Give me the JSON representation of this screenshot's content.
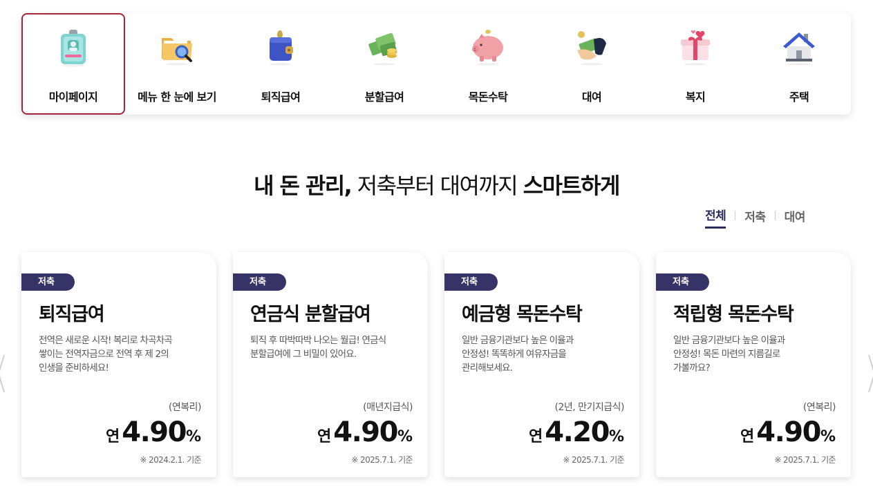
{
  "menu": {
    "items": [
      {
        "label": "마이페이지",
        "icon": "id-badge-icon"
      },
      {
        "label": "메뉴 한 눈에 보기",
        "icon": "folder-search-icon"
      },
      {
        "label": "퇴직급여",
        "icon": "wallet-icon"
      },
      {
        "label": "분할급여",
        "icon": "money-stack-icon"
      },
      {
        "label": "목돈수탁",
        "icon": "piggy-bank-icon"
      },
      {
        "label": "대여",
        "icon": "hand-money-icon"
      },
      {
        "label": "복지",
        "icon": "gift-box-icon"
      },
      {
        "label": "주택",
        "icon": "house-icon"
      }
    ],
    "active_index": 0,
    "active_color": "#a3243b"
  },
  "headline": {
    "part1": "내 돈 관리,",
    "part2": " 저축부터 대여까지 ",
    "part3": "스마트하게"
  },
  "filter": {
    "tabs": [
      "전체",
      "저축",
      "대여"
    ],
    "active_index": 0
  },
  "cards": [
    {
      "badge": "저축",
      "title": "퇴직급여",
      "desc": [
        "전역은 새로운 시작! 복리로 차곡차곡",
        "쌓이는 전역자금으로 전역 후 제 2의",
        "인생을 준비하세요!"
      ],
      "condition": "(연복리)",
      "rate_prefix": "연",
      "rate": "4.90",
      "rate_unit": "%",
      "note": "※ 2024.2.1. 기준"
    },
    {
      "badge": "저축",
      "title": "연금식 분할급여",
      "desc": [
        "퇴직 후 따박따박 나오는 월급! 연금식",
        "분할급여에 그 비밀이 있어요."
      ],
      "condition": "(매년지급식)",
      "rate_prefix": "연",
      "rate": "4.90",
      "rate_unit": "%",
      "note": "※ 2025.7.1. 기준"
    },
    {
      "badge": "저축",
      "title": "예금형 목돈수탁",
      "desc": [
        "일반 금융기관보다 높은 이율과",
        "안정성! 똑똑하게 여유자금을",
        "관리해보세요."
      ],
      "condition": "(2년, 만기지급식)",
      "rate_prefix": "연",
      "rate": "4.20",
      "rate_unit": "%",
      "note": "※ 2025.7.1. 기준"
    },
    {
      "badge": "저축",
      "title": "적립형 목돈수탁",
      "desc": [
        "일반 금융기관보다 높은 이율과",
        "안정성! 목돈 마련의 지름길로",
        "가볼까요?"
      ],
      "condition": "(연복리)",
      "rate_prefix": "연",
      "rate": "4.90",
      "rate_unit": "%",
      "note": "※ 2025.7.1. 기준"
    }
  ],
  "colors": {
    "badge_bg": "#363366",
    "filter_active": "#2b2b5c"
  }
}
